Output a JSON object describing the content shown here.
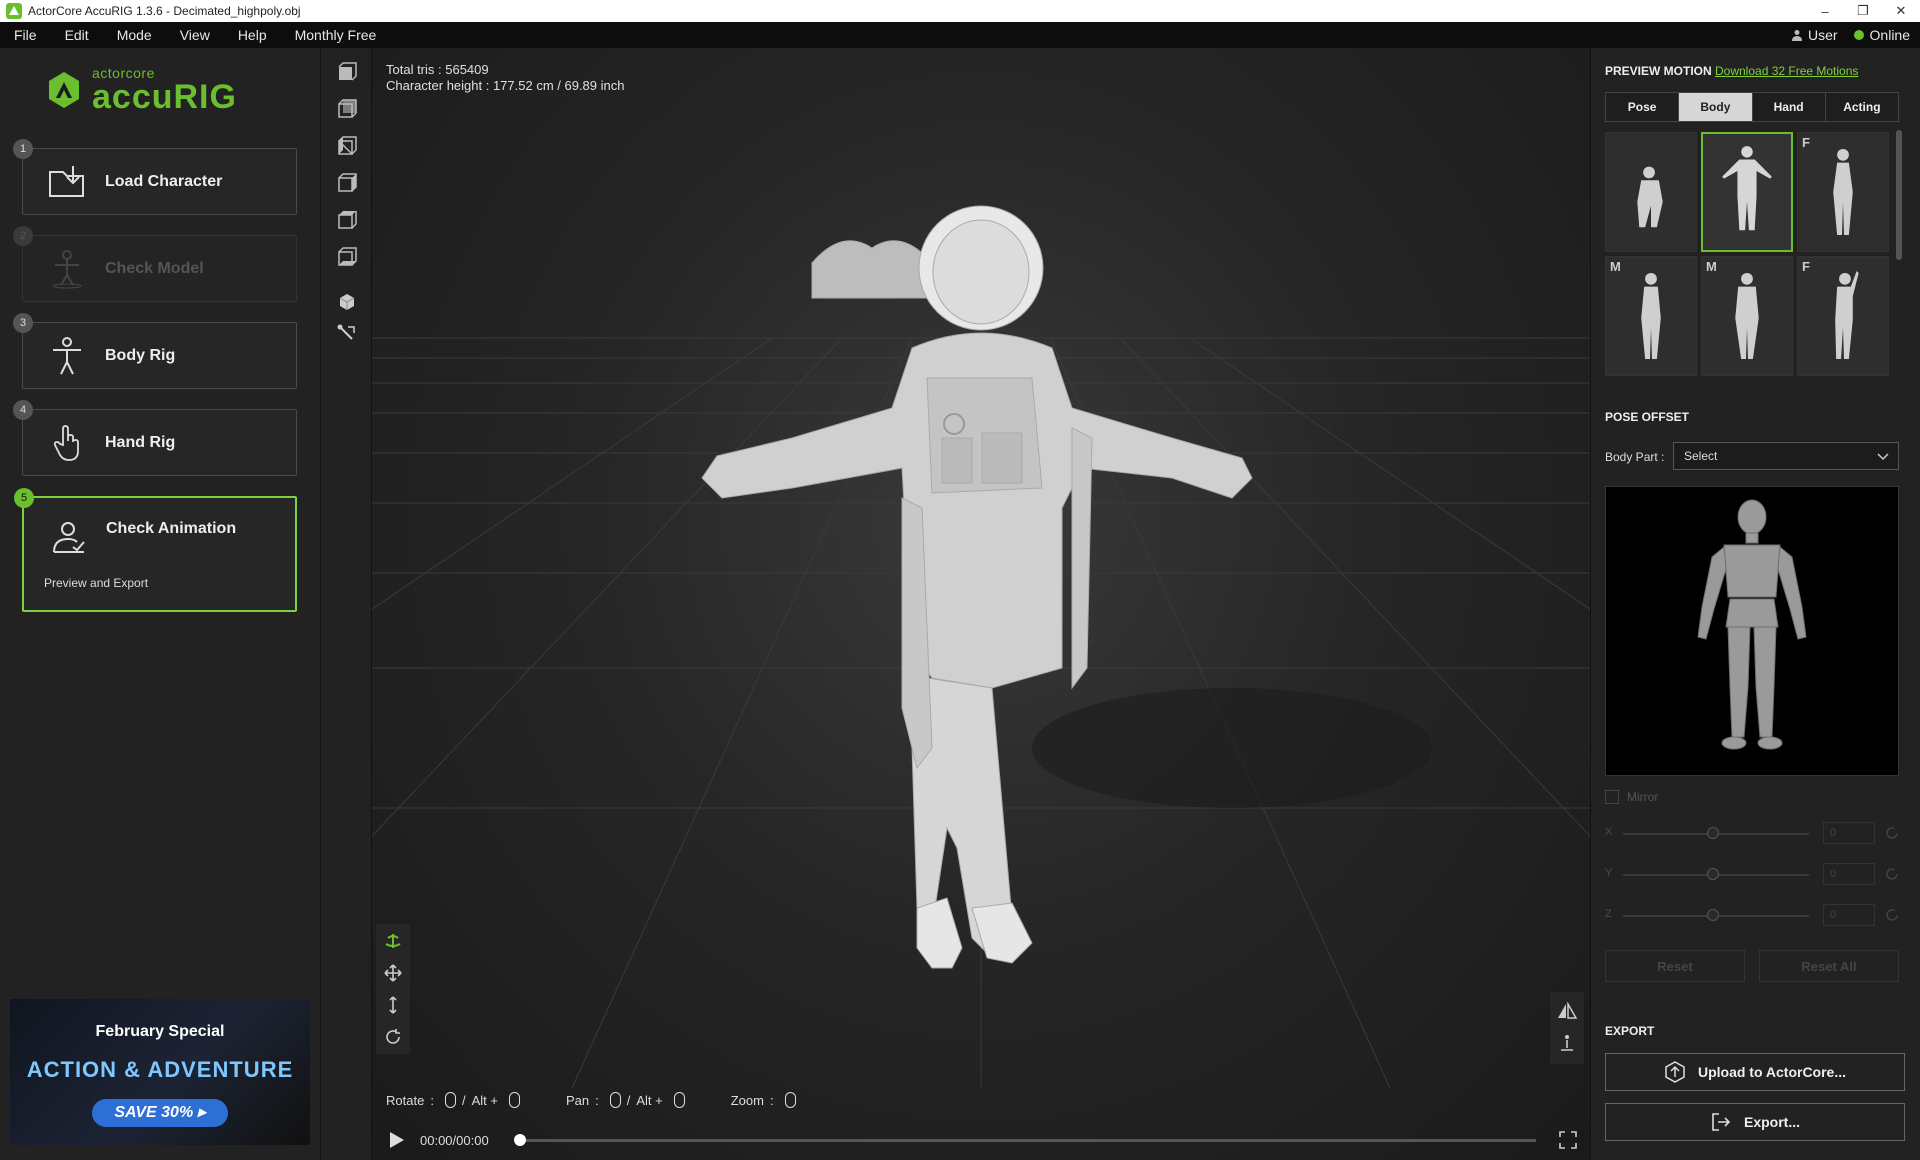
{
  "window": {
    "title": "ActorCore AccuRIG 1.3.6 - Decimated_highpoly.obj"
  },
  "menu": {
    "items": [
      "File",
      "Edit",
      "Mode",
      "View",
      "Help",
      "Monthly Free"
    ],
    "user": "User",
    "status": "Online"
  },
  "logo": {
    "small": "actorcore",
    "big": "accuRIG"
  },
  "steps": [
    {
      "num": "1",
      "label": "Load Character",
      "icon": "folder-import-icon",
      "state": "normal"
    },
    {
      "num": "2",
      "label": "Check Model",
      "icon": "model-figure-icon",
      "state": "disabled"
    },
    {
      "num": "3",
      "label": "Body Rig",
      "icon": "body-rig-icon",
      "state": "normal"
    },
    {
      "num": "4",
      "label": "Hand Rig",
      "icon": "hand-icon",
      "state": "normal"
    },
    {
      "num": "5",
      "label": "Check Animation",
      "sub": "Preview and Export",
      "icon": "person-check-icon",
      "state": "active"
    }
  ],
  "banner": {
    "line1": "February Special",
    "line2": "ACTION & ADVENTURE",
    "cta": "SAVE 30% ▸"
  },
  "viewport": {
    "total_tris": "Total tris : 565409",
    "height": "Character height : 177.52 cm / 69.89 inch",
    "hint_rotate": "Rotate",
    "hint_pan": "Pan",
    "hint_zoom": "Zoom",
    "hint_alt": "Alt +",
    "time": "00:00/00:00",
    "progress": 0
  },
  "right": {
    "preview_title": "PREVIEW MOTION",
    "download_link": "Download 32 Free Motions",
    "tabs": [
      "Pose",
      "Body",
      "Hand",
      "Acting"
    ],
    "selected_tab": "Body",
    "thumb_tags": [
      "",
      "",
      "F",
      "M",
      "M",
      "F"
    ],
    "pose_offset_title": "POSE OFFSET",
    "body_part_label": "Body Part :",
    "body_part_value": "Select",
    "mirror_label": "Mirror",
    "axes": [
      "X",
      "Y",
      "Z"
    ],
    "axis_values": [
      "0",
      "0",
      "0"
    ],
    "reset": "Reset",
    "reset_all": "Reset All",
    "export_title": "EXPORT",
    "upload_label": "Upload to ActorCore...",
    "export_label": "Export..."
  },
  "colors": {
    "accent": "#6abf2e",
    "viewport_bg": "#262626",
    "panel_bg": "#222222"
  }
}
